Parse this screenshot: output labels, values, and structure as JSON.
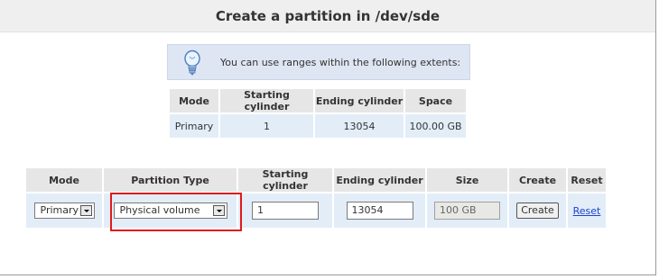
{
  "page": {
    "title": "Create a partition in /dev/sde"
  },
  "info": {
    "icon": "lightbulb-icon",
    "message": "You can use ranges within the following extents:"
  },
  "extents_table": {
    "headers": [
      "Mode",
      "Starting cylinder",
      "Ending cylinder",
      "Space"
    ],
    "rows": [
      [
        "Primary",
        "1",
        "13054",
        "100.00 GB"
      ]
    ]
  },
  "create_form": {
    "headers": [
      "Mode",
      "Partition Type",
      "Starting cylinder",
      "Ending cylinder",
      "Size",
      "Create",
      "Reset"
    ],
    "mode_value": "Primary",
    "partition_type_value": "Physical volume",
    "starting_cylinder_value": "1",
    "ending_cylinder_value": "13054",
    "size_value": "100 GB",
    "create_label": "Create",
    "reset_label": "Reset"
  },
  "colors": {
    "highlight_border": "#e01a1a",
    "link": "#1a44cc",
    "info_background": "#dfe6f3",
    "cell_background": "#e3edf8"
  }
}
